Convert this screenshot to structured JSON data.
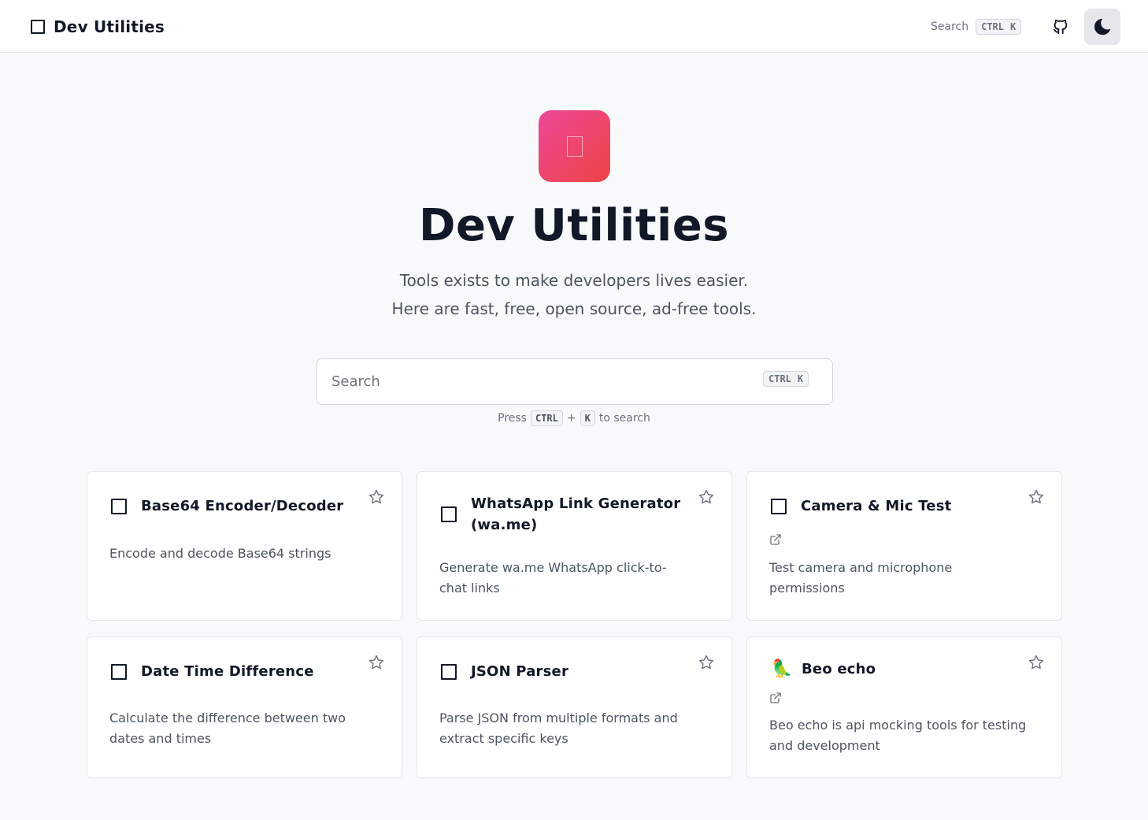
{
  "header": {
    "brand": "Dev Utilities",
    "search_label": "Search",
    "shortcut": [
      "CTRL",
      "K"
    ]
  },
  "hero": {
    "title": "Dev Utilities",
    "subtitle_line1": "Tools exists to make developers lives easier.",
    "subtitle_line2": "Here are fast, free, open source, ad-free tools."
  },
  "search": {
    "placeholder": "Search",
    "shortcut": [
      "CTRL",
      "K"
    ],
    "hint_press": "Press",
    "hint_plus": "+",
    "hint_suffix": "to search"
  },
  "colors": {
    "accent_gradient_start": "#ec4899",
    "accent_gradient_end": "#ef4444",
    "background": "#f8f9fb"
  },
  "tools": [
    {
      "title": "Base64 Encoder/Decoder",
      "description": "Encode and decode Base64 strings",
      "icon": "square-icon",
      "external": false
    },
    {
      "title": "WhatsApp Link Generator (wa.me)",
      "description": "Generate wa.me WhatsApp click-to-chat links",
      "icon": "square-icon",
      "external": false
    },
    {
      "title": "Camera & Mic Test",
      "description": "Test camera and microphone permissions",
      "icon": "square-icon",
      "external": true
    },
    {
      "title": "Date Time Difference",
      "description": "Calculate the difference between two dates and times",
      "icon": "square-icon",
      "external": false
    },
    {
      "title": "JSON Parser",
      "description": "Parse JSON from multiple formats and extract specific keys",
      "icon": "square-icon",
      "external": false
    },
    {
      "title": "Beo echo",
      "description": "Beo echo is api mocking tools for testing and development",
      "icon": "parrot-icon",
      "external": true
    }
  ]
}
